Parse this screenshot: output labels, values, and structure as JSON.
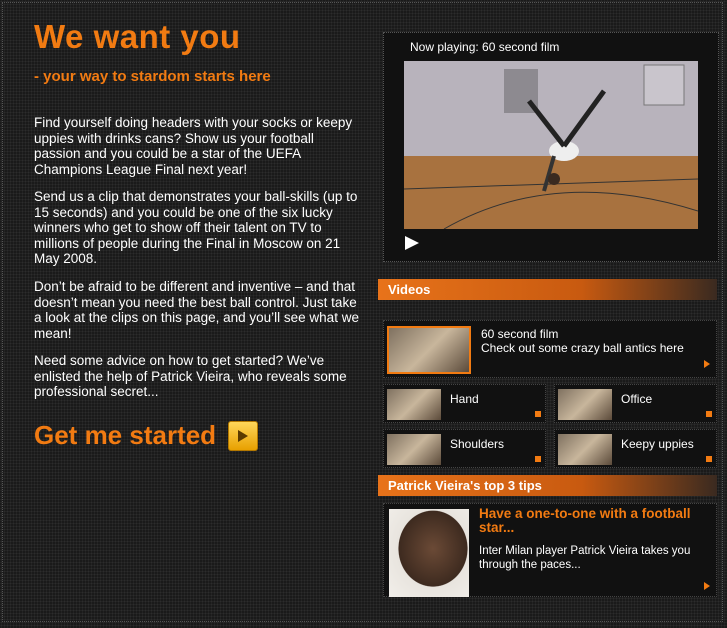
{
  "hero": {
    "title": "We want you",
    "subtitle": "- your way to stardom starts here",
    "paragraphs": [
      "Find yourself doing headers with your socks or keepy uppies with drinks cans? Show us your football passion and you could be a star of the UEFA Champions League Final next year!",
      "Send us a clip that demonstrates your ball-skills (up to 15 seconds) and you could be one of the six lucky winners who get to show off their talent on TV to millions of people during the Final in Moscow on 21 May 2008.",
      "Don’t be afraid to be different and inventive – and that doesn’t mean you need the best ball control. Just take a look at the clips on this page, and you’ll see what we mean!",
      "Need some advice on how to get started? We’ve enlisted the help of Patrick Vieira, who reveals some professional secret..."
    ],
    "cta_label": "Get me started"
  },
  "player": {
    "now_playing": "Now playing: 60 second film",
    "play_icon": "play-icon"
  },
  "videos": {
    "heading": "Videos",
    "featured": {
      "title": "60 second film",
      "description": "Check out some crazy ball antics here"
    },
    "items": [
      {
        "label": "Hand"
      },
      {
        "label": "Office"
      },
      {
        "label": "Shoulders"
      },
      {
        "label": "Keepy uppies"
      }
    ]
  },
  "tips": {
    "heading": "Patrick Vieira's top 3 tips",
    "headline": "Have a one-to-one with a football star...",
    "body": "Inter Milan player Patrick Vieira takes you through the paces..."
  },
  "colors": {
    "accent": "#f27b12",
    "background": "#1a1a1a"
  }
}
